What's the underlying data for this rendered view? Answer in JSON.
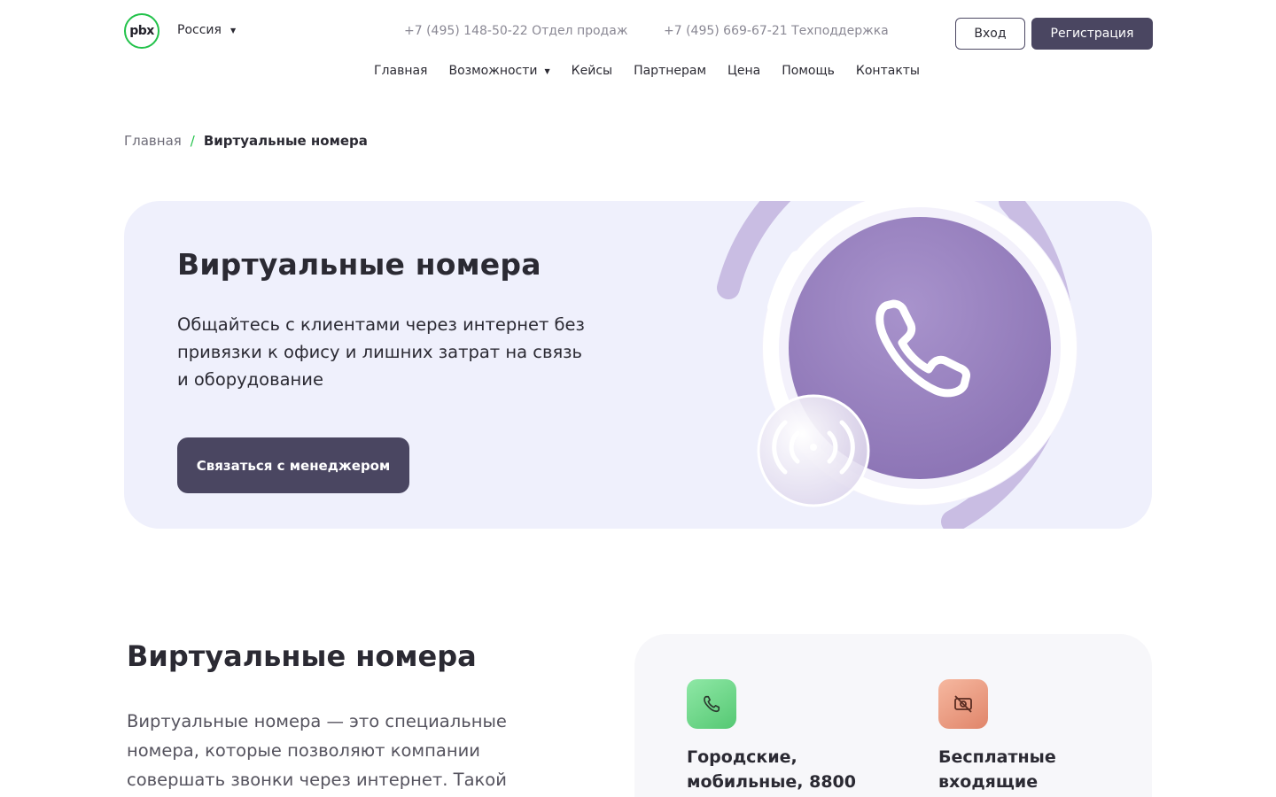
{
  "header": {
    "logo_text": "pbx",
    "region": "Россия",
    "phone_sales": "+7 (495) 148-50-22 Отдел продаж",
    "phone_support": "+7 (495) 669-67-21 Техподдержка",
    "login_label": "Вход",
    "register_label": "Регистрация"
  },
  "nav": {
    "items": [
      {
        "label": "Главная"
      },
      {
        "label": "Возможности"
      },
      {
        "label": "Кейсы"
      },
      {
        "label": "Партнерам"
      },
      {
        "label": "Цена"
      },
      {
        "label": "Помощь"
      },
      {
        "label": "Контакты"
      }
    ]
  },
  "breadcrumb": {
    "home": "Главная",
    "separator": "/",
    "current": "Виртуальные номера"
  },
  "hero": {
    "title": "Виртуальные номера",
    "subtitle": "Общайтесь с клиентами через интернет без привязки к офису и лишних затрат на связь и оборудование",
    "cta_label": "Связаться с менеджером",
    "icons": [
      "phone-icon",
      "signal-icon"
    ]
  },
  "section": {
    "title": "Виртуальные номера",
    "text": "Виртуальные номера — это специальные номера, которые позволяют компании совершать звонки через интернет. Такой",
    "features": [
      {
        "title": "Городские, мобильные, 8800",
        "icon": "phone-icon"
      },
      {
        "title": "Бесплатные входящие",
        "icon": "no-cash-icon"
      }
    ]
  },
  "colors": {
    "accent_green": "#22c24a",
    "button_dark": "#4a4661",
    "hero_bg": "#eff0fc",
    "circle_purple": "#9f88c4"
  }
}
